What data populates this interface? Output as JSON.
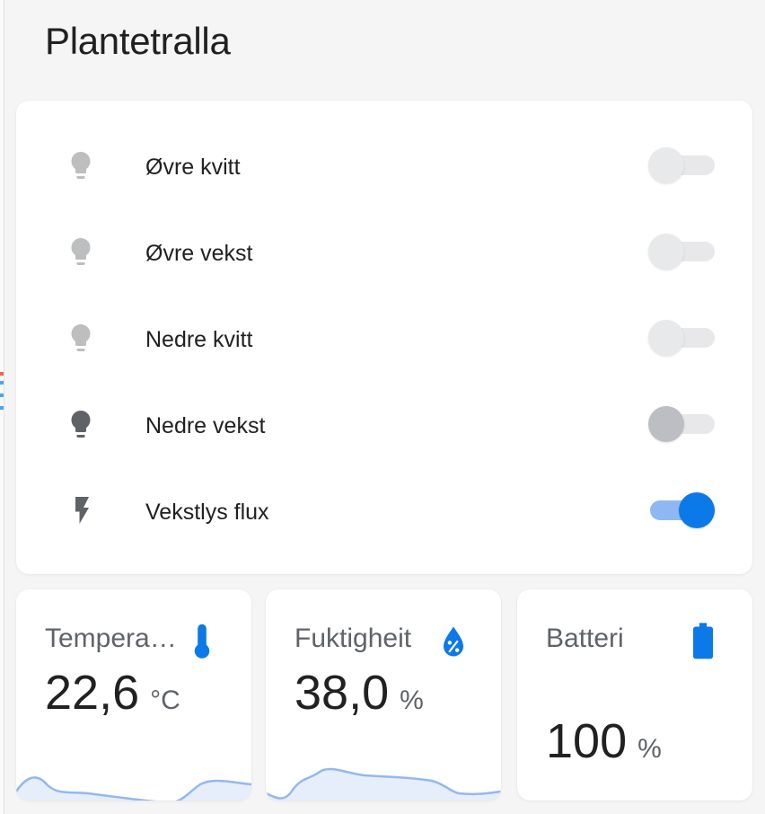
{
  "page": {
    "title": "Plantetralla"
  },
  "switches": [
    {
      "label": "Øvre kvitt",
      "icon": "lightbulb-icon",
      "state": "unavailable"
    },
    {
      "label": "Øvre vekst",
      "icon": "lightbulb-icon",
      "state": "unavailable"
    },
    {
      "label": "Nedre kvitt",
      "icon": "lightbulb-icon",
      "state": "unavailable"
    },
    {
      "label": "Nedre vekst",
      "icon": "lightbulb-icon",
      "state": "off"
    },
    {
      "label": "Vekstlys flux",
      "icon": "lightning-bolt-icon",
      "state": "on"
    }
  ],
  "sensors": {
    "temperature": {
      "name": "Tempera…",
      "value": "22,6",
      "unit": "°C",
      "icon": "thermometer-icon"
    },
    "humidity": {
      "name": "Fuktigheit",
      "value": "38,0",
      "unit": "%",
      "icon": "water-percent-icon"
    },
    "battery": {
      "name": "Batteri",
      "value": "100",
      "unit": "%",
      "icon": "battery-icon"
    }
  },
  "colors": {
    "accent": "#0b79e8",
    "icon_unavailable": "#bdbebf",
    "icon_off": "#5f6368",
    "sparkline_line": "#93b8ee",
    "sparkline_fill": "#e6eefb"
  }
}
